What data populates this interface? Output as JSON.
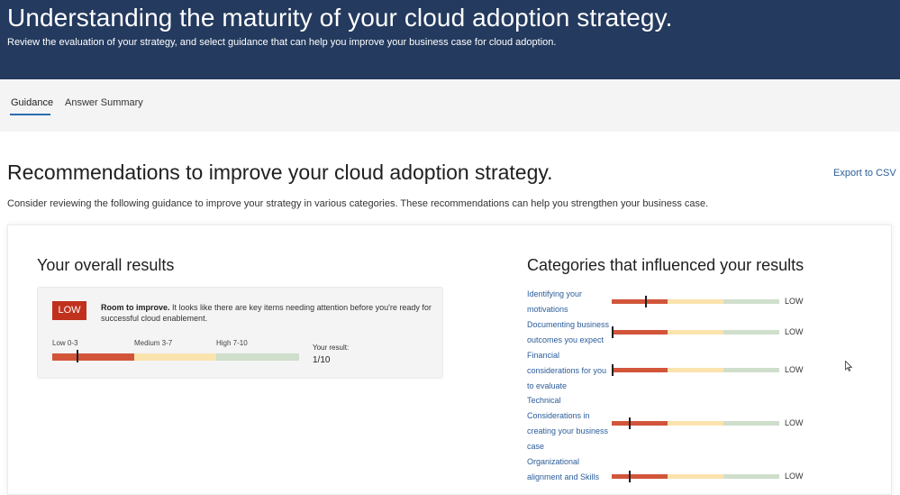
{
  "header": {
    "title": "Understanding the maturity of your cloud adoption strategy.",
    "subtitle": "Review the evaluation of your strategy, and select guidance that can help you improve your business case for cloud adoption."
  },
  "tabs": [
    {
      "label": "Guidance",
      "active": true
    },
    {
      "label": "Answer Summary",
      "active": false
    }
  ],
  "recommendations": {
    "title": "Recommendations to improve your cloud adoption strategy.",
    "export_label": "Export to CSV",
    "description": "Consider reviewing the following guidance to improve your strategy in various categories. These recommendations can help you strengthen your business case."
  },
  "overall": {
    "title": "Your overall results",
    "badge": "LOW",
    "headline": "Room to improve.",
    "message": " It looks like there are key items needing attention before you're ready for successful cloud enablement.",
    "scale": {
      "low": "Low 0-3",
      "medium": "Medium 3-7",
      "high": "High 7-10"
    },
    "result_label": "Your result:",
    "result_value": "1/10",
    "score": 1,
    "max": 10
  },
  "categories": {
    "title": "Categories that influenced your results",
    "items": [
      {
        "name": "Identifying your motivations",
        "level": "LOW",
        "score": 0.2
      },
      {
        "name": "Documenting business outcomes you expect",
        "level": "LOW",
        "score": 0.0
      },
      {
        "name": "Financial considerations for you to evaluate",
        "level": "LOW",
        "score": 0.0
      },
      {
        "name": "Technical Considerations in creating your business case",
        "level": "LOW",
        "score": 0.1
      },
      {
        "name": "Organizational alignment and Skills",
        "level": "LOW",
        "score": 0.1
      }
    ]
  },
  "colors": {
    "header_bg": "#243a5e",
    "low": "#d2553a",
    "medium": "#fbe3ae",
    "high": "#cfdfcc",
    "badge": "#c0311e",
    "link": "#2b5d9a"
  }
}
